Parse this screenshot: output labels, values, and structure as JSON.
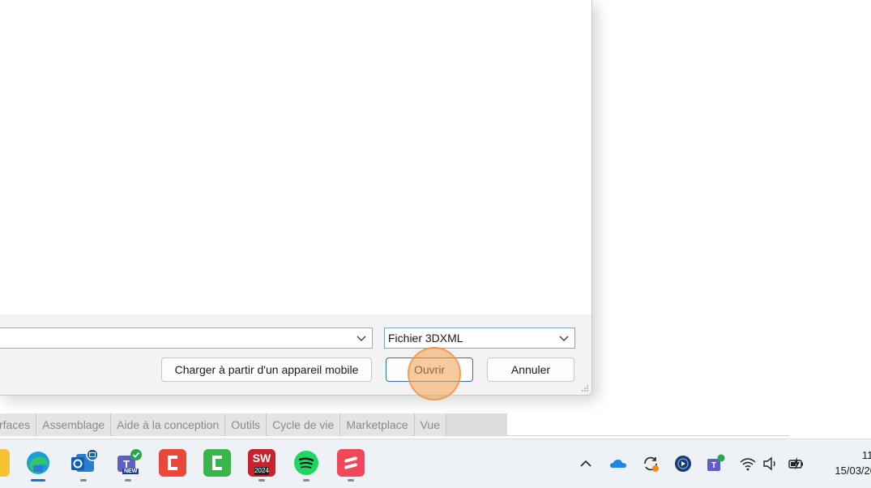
{
  "dialog": {
    "file_type_value": "Fichier 3DXML",
    "mobile_button_label": "Charger à partir d'un appareil mobile",
    "open_button_label": "Ouvrir",
    "cancel_button_label": "Annuler"
  },
  "ribbon": {
    "tabs": [
      "rfaces",
      "Assemblage",
      "Aide à la conception",
      "Outils",
      "Cycle de vie",
      "Marketplace",
      "Vue"
    ]
  },
  "taskbar": {
    "apps": [
      "file-explorer",
      "edge",
      "outlook",
      "teams",
      "camtasia",
      "camtasia-recorder",
      "solidworks-2024",
      "spotify",
      "scribe"
    ],
    "solidworks_badge": "2024",
    "teams_badge": "NEW",
    "clock_time": "11:",
    "clock_date": "15/03/20"
  },
  "colors": {
    "accent": "#2f6fb6",
    "cursor_halo": "#f5a050"
  }
}
